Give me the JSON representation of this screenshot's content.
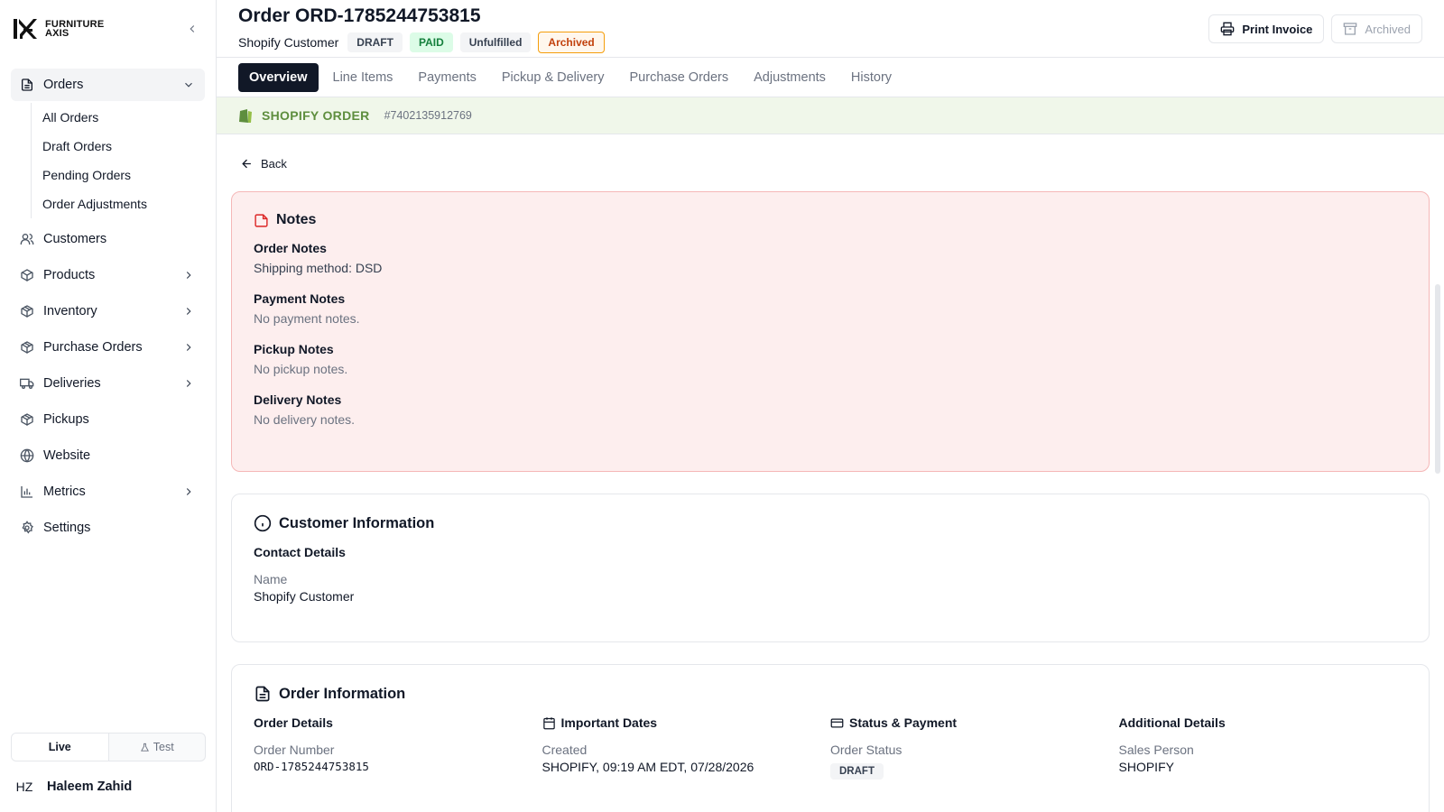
{
  "brand": {
    "line1": "FURNITURE",
    "line2": "AXIS"
  },
  "sidebar": {
    "orders": {
      "label": "Orders",
      "subitems": [
        "All Orders",
        "Draft Orders",
        "Pending Orders",
        "Order Adjustments"
      ]
    },
    "items": [
      {
        "label": "Customers",
        "icon": "users-icon",
        "chevron": false
      },
      {
        "label": "Products",
        "icon": "box-icon",
        "chevron": true
      },
      {
        "label": "Inventory",
        "icon": "package-icon",
        "chevron": true
      },
      {
        "label": "Purchase Orders",
        "icon": "package-icon",
        "chevron": true
      },
      {
        "label": "Deliveries",
        "icon": "truck-icon",
        "chevron": true
      },
      {
        "label": "Pickups",
        "icon": "package-icon",
        "chevron": false
      },
      {
        "label": "Website",
        "icon": "globe-icon",
        "chevron": false
      },
      {
        "label": "Metrics",
        "icon": "bar-chart-icon",
        "chevron": true
      },
      {
        "label": "Settings",
        "icon": "gear-icon",
        "chevron": false
      }
    ],
    "env": {
      "live": "Live",
      "test": "Test"
    },
    "user": {
      "initials": "HZ",
      "name": "Haleem Zahid"
    }
  },
  "header": {
    "title": "Order ORD-1785244753815",
    "customer": "Shopify Customer",
    "badges": {
      "draft": "DRAFT",
      "paid": "PAID",
      "unfulfilled": "Unfulfilled",
      "archived": "Archived"
    },
    "print_label": "Print Invoice",
    "archived_label": "Archived"
  },
  "tabs": [
    "Overview",
    "Line Items",
    "Payments",
    "Pickup & Delivery",
    "Purchase Orders",
    "Adjustments",
    "History"
  ],
  "shopify": {
    "label": "SHOPIFY ORDER",
    "id": "#7402135912769"
  },
  "back_label": "Back",
  "notes": {
    "title": "Notes",
    "order_notes": {
      "label": "Order Notes",
      "value": "Shipping method: DSD"
    },
    "payment_notes": {
      "label": "Payment Notes",
      "value": "No payment notes."
    },
    "pickup_notes": {
      "label": "Pickup Notes",
      "value": "No pickup notes."
    },
    "delivery_notes": {
      "label": "Delivery Notes",
      "value": "No delivery notes."
    }
  },
  "customer_info": {
    "title": "Customer Information",
    "section": "Contact Details",
    "name_label": "Name",
    "name_value": "Shopify Customer"
  },
  "order_info": {
    "title": "Order Information",
    "order_details": {
      "head": "Order Details",
      "label": "Order Number",
      "value": "ORD-1785244753815"
    },
    "important_dates": {
      "head": "Important Dates",
      "label": "Created",
      "value": "SHOPIFY, 09:19 AM EDT, 07/28/2026"
    },
    "status_payment": {
      "head": "Status & Payment",
      "label": "Order Status",
      "value": "DRAFT"
    },
    "additional": {
      "head": "Additional Details",
      "label": "Sales Person",
      "value": "SHOPIFY"
    }
  },
  "colors": {
    "shopify_green": "#5e8e3e",
    "notes_bg": "#fdeeee",
    "accent_dark": "#111827"
  }
}
